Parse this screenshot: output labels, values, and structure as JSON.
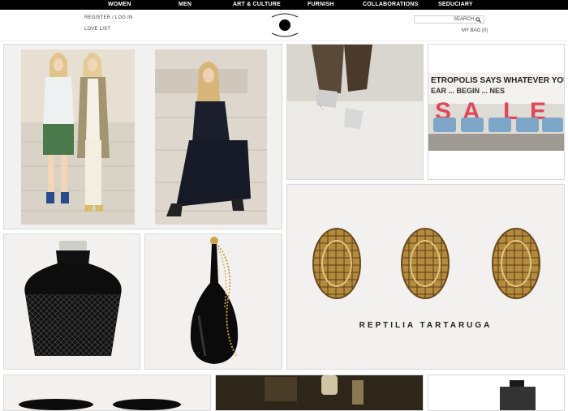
{
  "nav": {
    "items": [
      "WOMEN",
      "MEN",
      "ART & CULTURE",
      "FURNISH",
      "COLLABORATIONS",
      "SEDUCIARY"
    ]
  },
  "header": {
    "register_label": "REGISTER / LOG IN",
    "love_list_label": "LOVE LIST",
    "search_label": "SEARCH",
    "bag_label": "MY BAG (0)"
  },
  "tiles": {
    "jewelry_caption": "REPTILIA TARTARUGA",
    "sale_banner_line1": "ETROPOLIS SAYS WHATEVER YOU",
    "sale_banner_line2": "EAR ... BEGIN ... NES",
    "sale_letters": [
      "S",
      "A",
      "L",
      "E"
    ]
  },
  "colors": {
    "nav_bg": "#000000",
    "tile_bg": "#f2f1ef",
    "sale_red": "#e0485a",
    "seat_blue": "#7ea6c8"
  }
}
